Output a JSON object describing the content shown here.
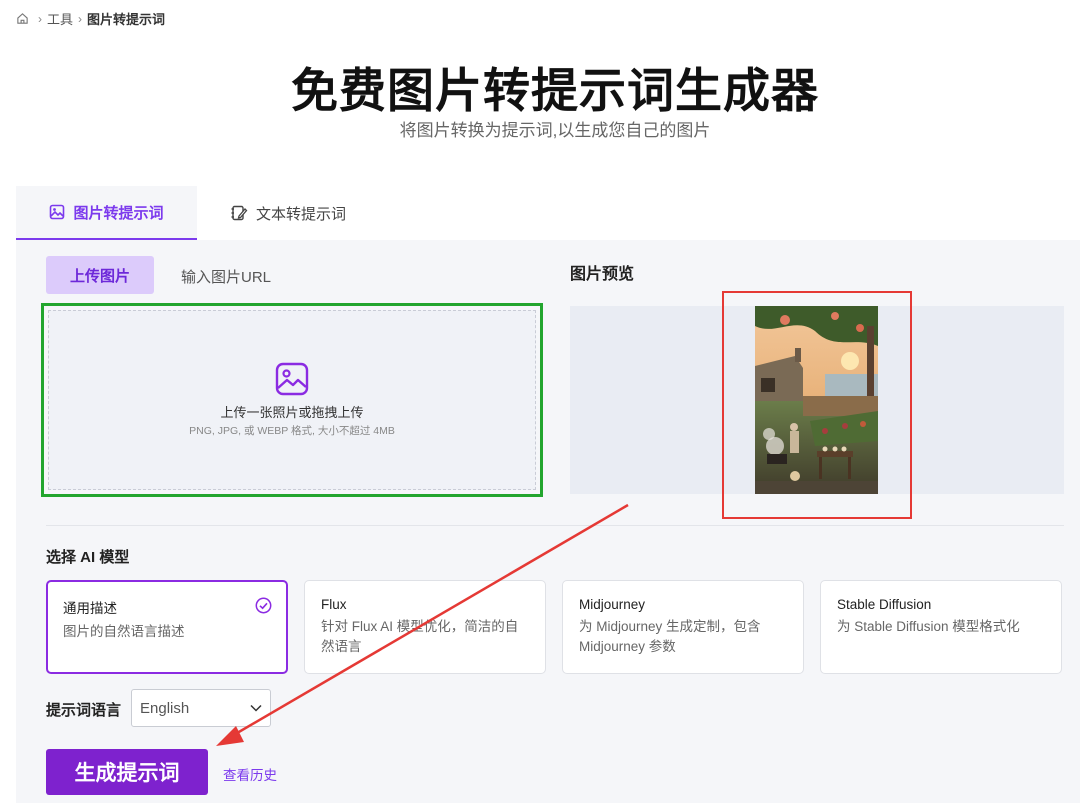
{
  "breadcrumb": {
    "items": [
      "工具",
      "图片转提示词"
    ]
  },
  "header": {
    "title": "免费图片转提示词生成器",
    "subtitle": "将图片转换为提示词,以生成您自己的图片"
  },
  "tabs": [
    {
      "label": "图片转提示词",
      "icon": "image-prompt-icon",
      "active": true
    },
    {
      "label": "文本转提示词",
      "icon": "edit-note-icon",
      "active": false
    }
  ],
  "upload": {
    "tabs": [
      "上传图片",
      "输入图片URL"
    ],
    "main_text": "上传一张照片或拖拽上传",
    "hint_text": "PNG, JPG, 或 WEBP 格式, 大小不超过 4MB"
  },
  "preview": {
    "label": "图片预览"
  },
  "models": {
    "label": "选择 AI 模型",
    "items": [
      {
        "name": "通用描述",
        "desc": "图片的自然语言描述",
        "selected": true
      },
      {
        "name": "Flux",
        "desc": "针对 Flux AI 模型优化，简洁的自然语言",
        "selected": false
      },
      {
        "name": "Midjourney",
        "desc": "为 Midjourney 生成定制，包含 Midjourney 参数",
        "selected": false
      },
      {
        "name": "Stable Diffusion",
        "desc": "为 Stable Diffusion 模型格式化",
        "selected": false
      }
    ]
  },
  "language": {
    "label": "提示词语言",
    "selected": "English"
  },
  "actions": {
    "generate_label": "生成提示词",
    "history_label": "查看历史"
  },
  "colors": {
    "accent": "#7e22ce",
    "annotation_red": "#e53935",
    "annotation_green": "#22a52e"
  }
}
